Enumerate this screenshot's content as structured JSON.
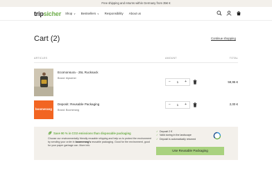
{
  "announcement": "Free shipping and returns within Germany from 35€ €",
  "brand": {
    "logo_main": "trip",
    "logo_accent": "sicher"
  },
  "nav": {
    "items": [
      {
        "label": "Shop",
        "dropdown": true
      },
      {
        "label": "Bestsellers",
        "dropdown": true
      },
      {
        "label": "Responsibility",
        "dropdown": false
      },
      {
        "label": "About us",
        "dropdown": false
      }
    ]
  },
  "header_icons": [
    "search-icon",
    "user-icon",
    "cart-icon"
  ],
  "cart": {
    "title": "Cart (2)",
    "continue_label": "Continue shopping",
    "columns": {
      "articles": "ARTICLES",
      "amount": "AMOUNT",
      "total": "TOTAL"
    },
    "items": [
      {
        "name": "Ecomonsura - 25L Rucksack",
        "brand": "Brand: tripsicher",
        "qty": "1",
        "price": "59,95 €",
        "thumb": "backpack"
      },
      {
        "name": "Deposit: Reusable Packaging",
        "brand": "Brand: Boomerang",
        "qty": "1",
        "price": "2,00 €",
        "thumb": "boomerang",
        "thumb_text": "boomerang"
      }
    ],
    "qty_minus": "−",
    "qty_plus": "+"
  },
  "eco_panel": {
    "title": "Save 90 % in CO2 emissions than disposable packaging",
    "text_before": "Choose our environmentally friendly reusable shipping and help us to protect the environment by sending your order in ",
    "text_bold": "boomerang's",
    "text_after": " reusable packaging. Good for the environment, good for your paper garbage can. More info",
    "checks": [
      "Deposit 2 €",
      "Valid during in the landscape",
      "Deposit is automatically returned"
    ],
    "button_label": "Use Reusable Packaging"
  },
  "colors": {
    "accent_green": "#6fae4c",
    "button_green": "#a9d27f",
    "panel_bg": "#f3f0eb",
    "boomerang_orange": "#f26522"
  }
}
